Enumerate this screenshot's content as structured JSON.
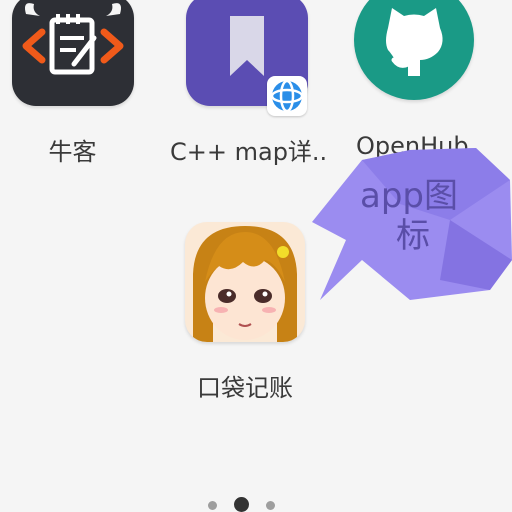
{
  "apps": [
    {
      "name": "牛客",
      "icon": "nowcoder-icon"
    },
    {
      "name": "C++ map详..",
      "icon": "cpp-map-bookmark-icon",
      "badge": "browser-globe-icon"
    },
    {
      "name": "OpenHub",
      "icon": "github-octocat-icon"
    },
    {
      "name": "口袋记账",
      "icon": "anime-girl-avatar-icon"
    }
  ],
  "annotation": {
    "line1": "app图",
    "line2": "标",
    "color": "#8f7fe8"
  },
  "pager": {
    "count": 3,
    "active_index": 1
  },
  "colors": {
    "background": "#f5f5f5",
    "nowcoder_bg": "#2d2f35",
    "nowcoder_accent": "#f05a1a",
    "cppmap_bg": "#5b4db3",
    "openhub_bg": "#1a9a86"
  }
}
